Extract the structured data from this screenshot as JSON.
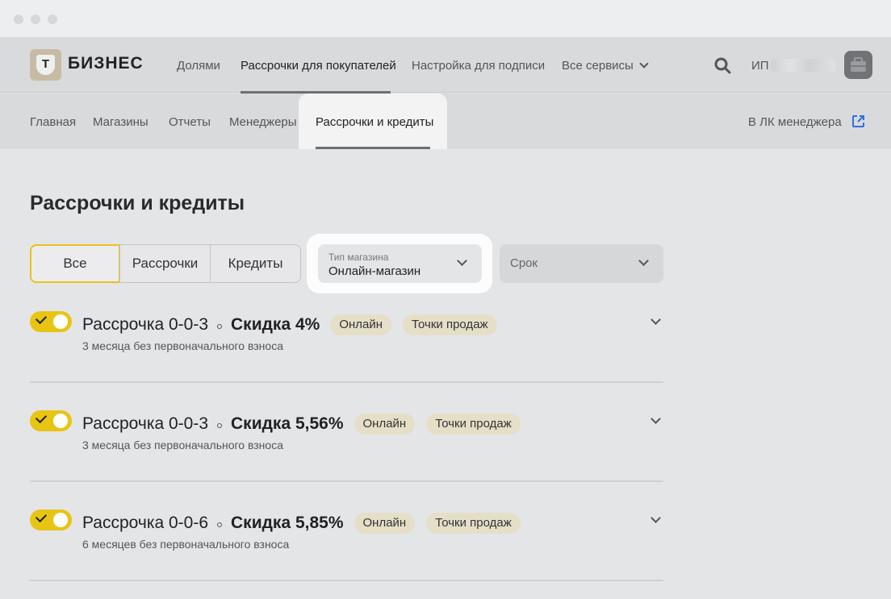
{
  "header": {
    "logo_letter": "Т",
    "logo_text": "БИЗНЕС",
    "nav": [
      {
        "label": "Долями"
      },
      {
        "label": "Рассрочки для покупателей"
      },
      {
        "label": "Настройка для подписи"
      },
      {
        "label": "Все сервисы"
      }
    ],
    "user_prefix": "ИП"
  },
  "subnav": {
    "items": [
      {
        "label": "Главная"
      },
      {
        "label": "Магазины"
      },
      {
        "label": "Отчеты"
      },
      {
        "label": "Менеджеры"
      },
      {
        "label": "Рассрочки и кредиты"
      }
    ],
    "manager_link": "В ЛК менеджера"
  },
  "page": {
    "title": "Рассрочки и кредиты",
    "segments": [
      {
        "label": "Все"
      },
      {
        "label": "Рассрочки"
      },
      {
        "label": "Кредиты"
      }
    ],
    "store_type": {
      "label": "Тип магазина",
      "value": "Онлайн-магазин"
    },
    "term": {
      "placeholder": "Срок"
    }
  },
  "offers": [
    {
      "name": "Рассрочка 0-0-3",
      "discount": "Скидка 4%",
      "chip1": "Онлайн",
      "chip2": "Точки продаж",
      "desc": "3 месяца без первоначального взноса"
    },
    {
      "name": "Рассрочка 0-0-3",
      "discount": "Скидка 5,56%",
      "chip1": "Онлайн",
      "chip2": "Точки продаж",
      "desc": "3 месяца без первоначального взноса"
    },
    {
      "name": "Рассрочка 0-0-6",
      "discount": "Скидка 5,85%",
      "chip1": "Онлайн",
      "chip2": "Точки продаж",
      "desc": "6 месяцев без первоначального взноса"
    }
  ],
  "colors": {
    "accent": "#e8c415",
    "chip_bg": "#e5dfc8",
    "link_blue": "#2f6fe0"
  }
}
